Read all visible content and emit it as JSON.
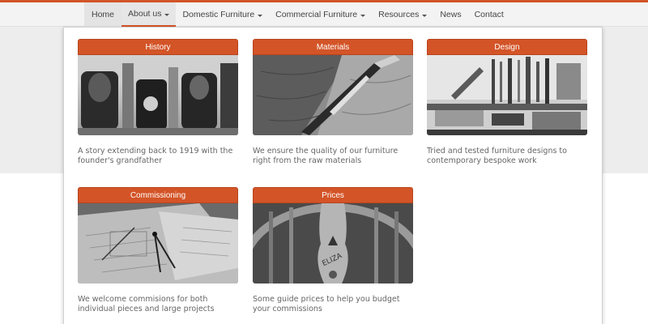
{
  "nav": {
    "items": [
      {
        "label": "Home",
        "dropdown": false
      },
      {
        "label": "About us",
        "dropdown": true
      },
      {
        "label": "Domestic Furniture",
        "dropdown": true
      },
      {
        "label": "Commercial Furniture",
        "dropdown": true
      },
      {
        "label": "Resources",
        "dropdown": true
      },
      {
        "label": "News",
        "dropdown": false
      },
      {
        "label": "Contact",
        "dropdown": false
      }
    ],
    "active_index": 1
  },
  "dropdown": {
    "cards": [
      {
        "title": "History",
        "description": "A story extending back to 1919 with the founder's grandfather",
        "image": "woodworking-planes-photo"
      },
      {
        "title": "Materials",
        "description": "We ensure the quality of our furniture right from the raw materials",
        "image": "chisel-on-wood-photo"
      },
      {
        "title": "Design",
        "description": "Tried and tested furniture designs to contemporary bespoke work",
        "image": "workshop-tools-photo"
      },
      {
        "title": "Commissioning",
        "description": "We welcome commisions for both individual pieces and large projects",
        "image": "drafting-drawings-photo"
      },
      {
        "title": "Prices",
        "description": "Some guide prices to help you budget your commissions",
        "image": "eliza-chair-back-photo"
      }
    ]
  },
  "colors": {
    "accent": "#d35427",
    "navbar_bg": "#f3f3f3",
    "page_bg": "#ededed"
  }
}
